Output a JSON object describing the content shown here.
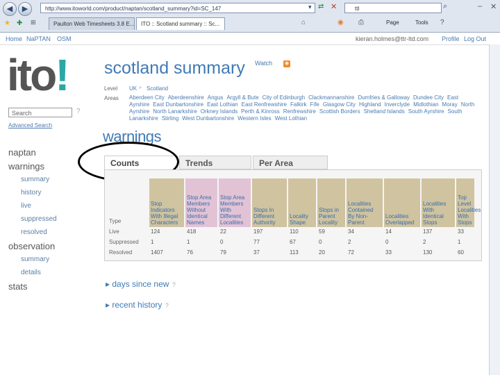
{
  "browser": {
    "address": "http://www.itoworld.com/product/naptan/scotland_summary?id=SC_147",
    "search_value": "ttl",
    "tabs": [
      "Paulton Web Timesheets 3.8 E...",
      "ITO :: Scotland summary :: Sc..."
    ],
    "commands": {
      "page": "Page",
      "tools": "Tools"
    }
  },
  "topnav": {
    "left": [
      "Home",
      "NaPTAN",
      "OSM"
    ],
    "user": "kieran.holmes@ttr-ltd.com",
    "profile": "Profile",
    "logout": "Log Out"
  },
  "logo": {
    "text": "ito",
    "bang": "!"
  },
  "sidebar": {
    "search_placeholder": "Search",
    "advanced": "Advanced Search",
    "items": [
      {
        "label": "naptan",
        "level": 1
      },
      {
        "label": "warnings",
        "level": 1
      },
      {
        "label": "summary",
        "level": 2
      },
      {
        "label": "history",
        "level": 2
      },
      {
        "label": "live",
        "level": 2
      },
      {
        "label": "suppressed",
        "level": 2
      },
      {
        "label": "resolved",
        "level": 2
      },
      {
        "label": "observation",
        "level": 1
      },
      {
        "label": "summary",
        "level": 2
      },
      {
        "label": "details",
        "level": 2
      },
      {
        "label": "stats",
        "level": 1
      }
    ]
  },
  "page": {
    "title": "scotland summary",
    "watch": "Watch",
    "level_label": "Level",
    "level_crumbs": [
      "UK",
      "Scotland"
    ],
    "areas_label": "Areas",
    "areas": [
      "Aberdeen City",
      "Aberdeenshire",
      "Angus",
      "Argyll & Bute",
      "City of Edinburgh",
      "Clackmannanshire",
      "Dumfries & Galloway",
      "Dundee City",
      "East Ayrshire",
      "East Dunbartonshire",
      "East Lothian",
      "East Renfrewshire",
      "Falkirk",
      "Fife",
      "Glasgow City",
      "Highland",
      "Inverclyde",
      "Midlothian",
      "Moray",
      "North Ayrshire",
      "North Lanarkshire",
      "Orkney Islands",
      "Perth & Kinross",
      "Renfrewshire",
      "Scottish Borders",
      "Shetland Islands",
      "South Ayrshire",
      "South Lanarkshire",
      "Stirling",
      "West Dunbartonshire",
      "Western Isles",
      "West Lothian"
    ],
    "warnings_heading": "warnings",
    "tabs": [
      "Counts",
      "Trends",
      "Per Area"
    ]
  },
  "table": {
    "type_header": "Type",
    "columns": [
      {
        "label": "Stop Indicators With Illegal Characters",
        "color": "#cfc3a0"
      },
      {
        "label": "Stop Area Members Without Identical Names",
        "color": "#e2c3d6"
      },
      {
        "label": "Stop Area Members With Different Localities",
        "color": "#e2c3d6"
      },
      {
        "label": "Stops In Different Authority",
        "color": "#cfc3a0"
      },
      {
        "label": "Locality Shape",
        "color": "#cfc3a0"
      },
      {
        "label": "Stops in Parent Locality",
        "color": "#cfc3a0"
      },
      {
        "label": "Localities Contained By Non-Parent",
        "color": "#cfc3a0"
      },
      {
        "label": "Localities Overlapped",
        "color": "#cfc3a0"
      },
      {
        "label": "Localities With Identical Stops",
        "color": "#cfc3a0"
      },
      {
        "label": "Top Level Localities With Stops",
        "color": "#cfc3a0"
      }
    ],
    "rows": [
      {
        "type": "Live",
        "values": [
          "124",
          "418",
          "22",
          "197",
          "110",
          "59",
          "34",
          "14",
          "137",
          "33"
        ]
      },
      {
        "type": "Suppressed",
        "values": [
          "1",
          "1",
          "0",
          "77",
          "67",
          "0",
          "2",
          "0",
          "2",
          "1"
        ]
      },
      {
        "type": "Resolved",
        "values": [
          "1407",
          "76",
          "79",
          "37",
          "113",
          "20",
          "72",
          "33",
          "130",
          "60"
        ]
      }
    ]
  },
  "sections": [
    "days since new",
    "recent history"
  ]
}
